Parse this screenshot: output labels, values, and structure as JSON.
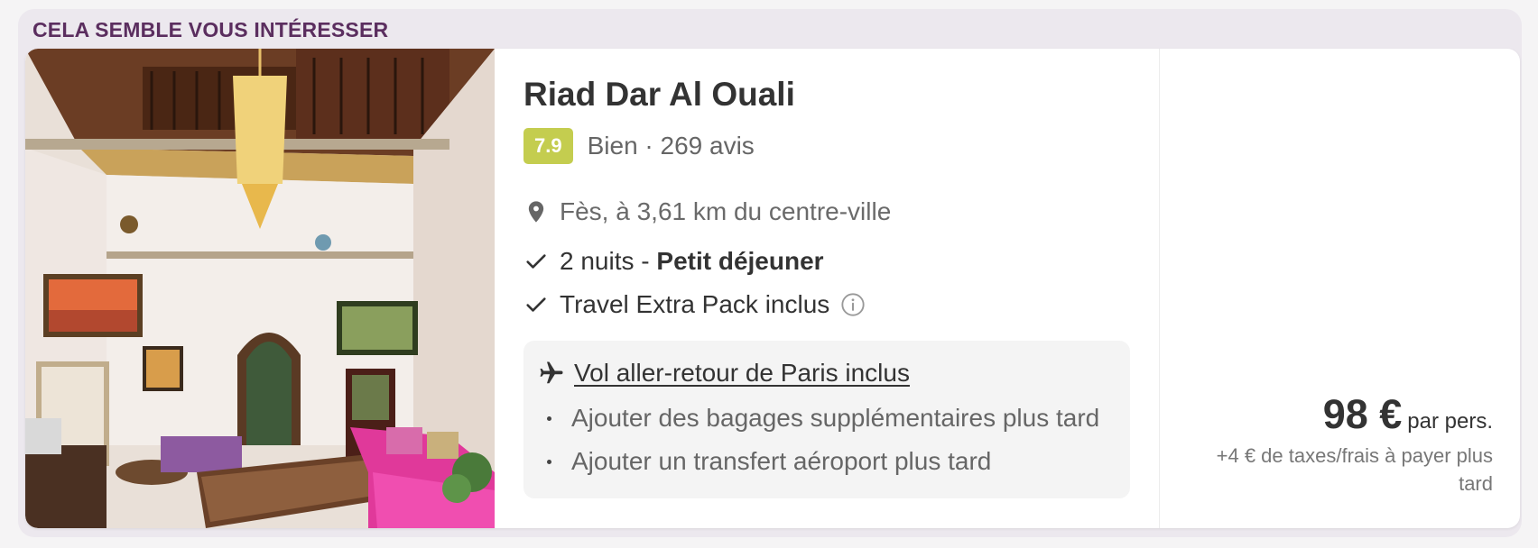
{
  "section": {
    "title": "CELA SEMBLE VOUS INTÉRESSER"
  },
  "hotel": {
    "name": "Riad Dar Al Ouali",
    "score": "7.9",
    "rating_text": "Bien · 269 avis",
    "location": "Fès, à 3,61 km du centre-ville",
    "stay_prefix": "2 nuits - ",
    "stay_board": "Petit déjeuner",
    "extra": "Travel Extra Pack inclus"
  },
  "flight": {
    "title": "Vol aller-retour de Paris inclus",
    "options": [
      "Ajouter des bagages supplémentaires plus tard",
      "Ajouter un transfert aéroport plus tard"
    ]
  },
  "price": {
    "amount": "98 €",
    "unit": "par pers.",
    "note": "+4 € de taxes/frais à payer plus tard"
  },
  "colors": {
    "brand_title": "#5b2e5f",
    "score_badge": "#c4cd4f",
    "card_bg": "#ffffff",
    "outer_bg": "#ece8ee"
  },
  "icons": [
    "location-pin-icon",
    "check-icon",
    "info-icon",
    "airplane-icon"
  ]
}
